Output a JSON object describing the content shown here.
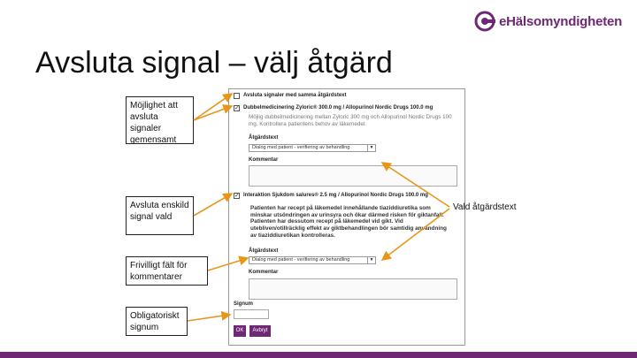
{
  "logo": {
    "text": "eHälsomyndigheten",
    "color": "#6e2874"
  },
  "slide": {
    "title": "Avsluta signal – välj åtgärd"
  },
  "callouts": {
    "jointly": "Möjlighet att avsluta signaler gemensamt",
    "single": "Avsluta enskild signal vald",
    "optional": "Frivilligt fält för kommentarer",
    "mandatory": "Obligatoriskt signum",
    "chosen_action": "Vald åtgärdstext",
    "arrow_color": "#e8961a"
  },
  "panel": {
    "same_action_label": "Avsluta signaler med samma åtgärdstext",
    "signal1": {
      "title": "Dubbelmedicinering Zyloric® 300.0 mg / Allopurinol Nordic Drugs 100.0 mg",
      "description": "Möjlig dubbelmedicinering mellan Zyloric 300 mg och Allopurinol Nordic Drugs 100 mg. Kontrollera patientens behov av läkemedel.",
      "action_label": "Åtgärdstext",
      "action_value": "Dialog med patient - verifiering av behandling",
      "comment_label": "Kommentar"
    },
    "signal2": {
      "title": "Interaktion Sjukdom salures® 2.5 mg / Allopurinol Nordic Drugs 100.0 mg",
      "warning": "Patienten har recept på läkemedel innehållande tiaziddiuretika som minskar utsöndringen av urinsyra och ökar därmed risken för giktanfall. Patienten har dessutom recept på läkemedel vid gikt. Vid utebliven/otillräcklig effekt av giktbehandlingen bör samtidig användning av tiaziddiuretikan kontrolleras.",
      "action_label": "Åtgärdstext",
      "action_value": "Dialog med patient - verifiering av behandling",
      "comment_label": "Kommentar"
    },
    "signum_label": "Signum",
    "ok_label": "OK",
    "cancel_label": "Avbryt"
  }
}
